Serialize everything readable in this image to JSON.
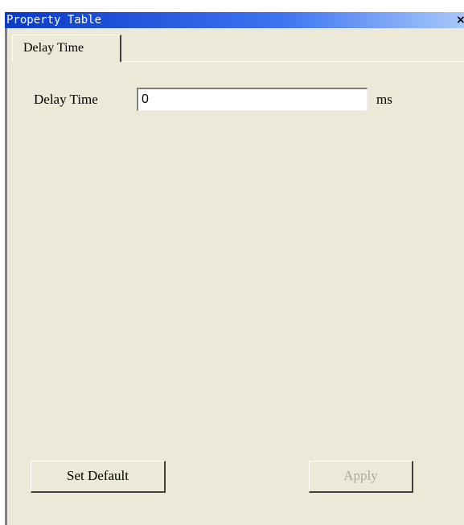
{
  "window": {
    "title": "Property Table"
  },
  "tabs": [
    {
      "label": "Delay Time",
      "selected": true
    }
  ],
  "form": {
    "delay_label": "Delay Time",
    "delay_value": "0",
    "delay_unit": "ms"
  },
  "buttons": {
    "set_default_label": "Set Default",
    "apply_label": "Apply",
    "apply_enabled": false
  },
  "colors": {
    "titlebar_start": "#0a3ac8",
    "titlebar_end": "#a8c8fa",
    "panel_background": "#ece9d8",
    "disabled_text": "#aca899"
  },
  "icons": {
    "close": "close-icon"
  }
}
